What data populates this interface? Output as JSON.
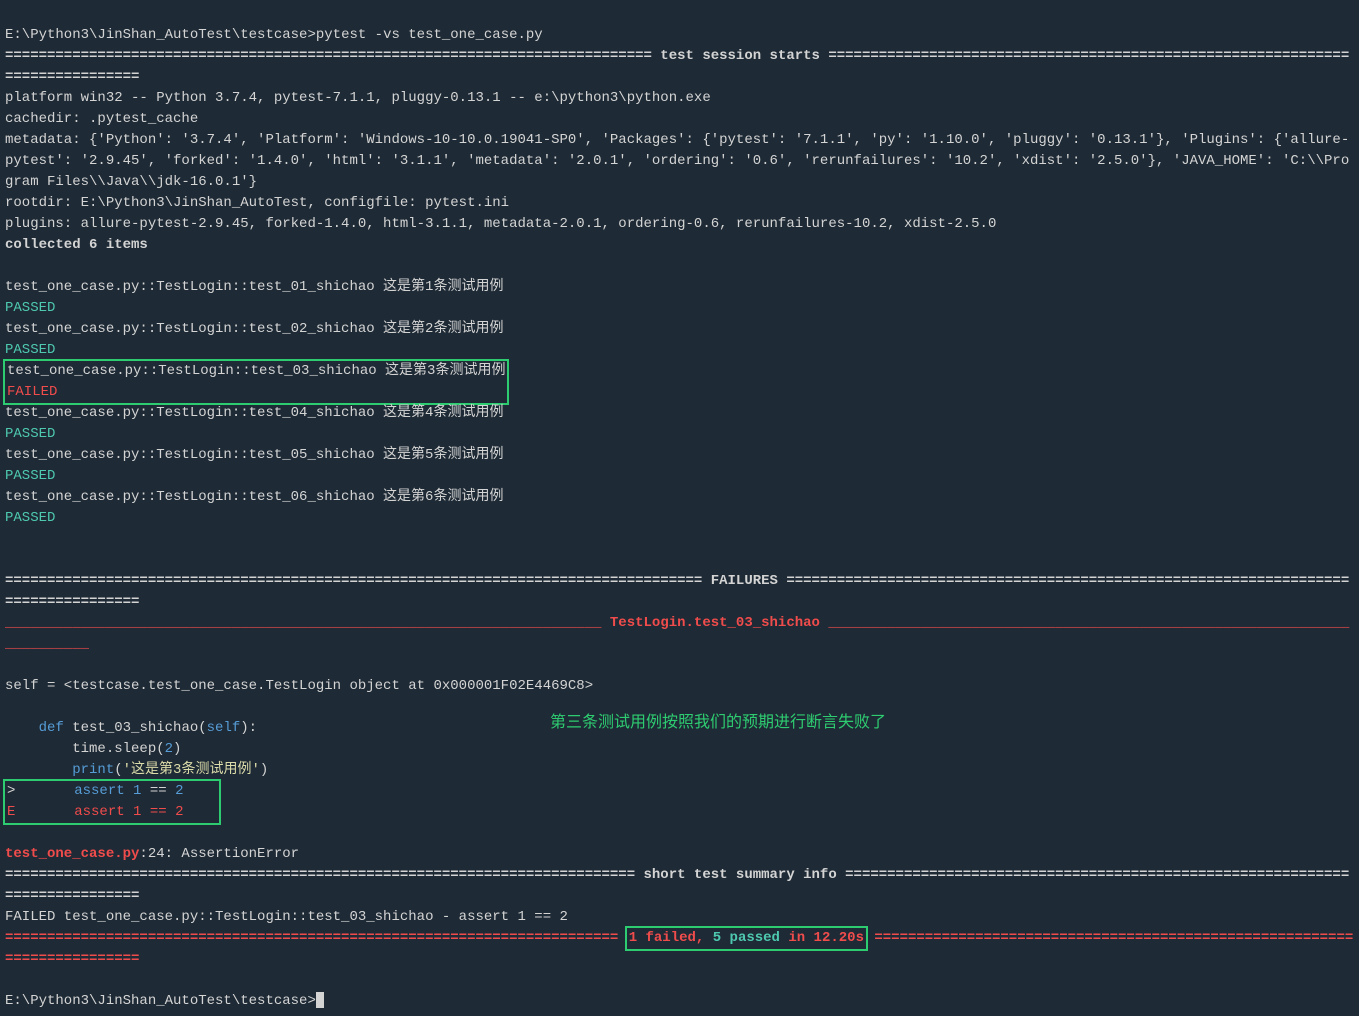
{
  "prompt1": "E:\\Python3\\JinShan_AutoTest\\testcase>",
  "command": "pytest -vs test_one_case.py",
  "session_start_line": "============================================================================= test session starts ==============================================================================",
  "platform_line": "platform win32 -- Python 3.7.4, pytest-7.1.1, pluggy-0.13.1 -- e:\\python3\\python.exe",
  "cachedir_line": "cachedir: .pytest_cache",
  "metadata_line": "metadata: {'Python': '3.7.4', 'Platform': 'Windows-10-10.0.19041-SP0', 'Packages': {'pytest': '7.1.1', 'py': '1.10.0', 'pluggy': '0.13.1'}, 'Plugins': {'allure-pytest': '2.9.45', 'forked': '1.4.0', 'html': '3.1.1', 'metadata': '2.0.1', 'ordering': '0.6', 'rerunfailures': '10.2', 'xdist': '2.5.0'}, 'JAVA_HOME': 'C:\\\\Program Files\\\\Java\\\\jdk-16.0.1'}",
  "rootdir_line": "rootdir: E:\\Python3\\JinShan_AutoTest, configfile: pytest.ini",
  "plugins_line": "plugins: allure-pytest-2.9.45, forked-1.4.0, html-3.1.1, metadata-2.0.1, ordering-0.6, rerunfailures-10.2, xdist-2.5.0",
  "collected_line": "collected 6 items",
  "tests": [
    {
      "line": "test_one_case.py::TestLogin::test_01_shichao 这是第1条测试用例",
      "result": "PASSED",
      "passed": true,
      "highlight": false
    },
    {
      "line": "test_one_case.py::TestLogin::test_02_shichao 这是第2条测试用例",
      "result": "PASSED",
      "passed": true,
      "highlight": false
    },
    {
      "line": "test_one_case.py::TestLogin::test_03_shichao 这是第3条测试用例",
      "result": "FAILED",
      "passed": false,
      "highlight": true
    },
    {
      "line": "test_one_case.py::TestLogin::test_04_shichao 这是第4条测试用例",
      "result": "PASSED",
      "passed": true,
      "highlight": false
    },
    {
      "line": "test_one_case.py::TestLogin::test_05_shichao 这是第5条测试用例",
      "result": "PASSED",
      "passed": true,
      "highlight": false
    },
    {
      "line": "test_one_case.py::TestLogin::test_06_shichao 这是第6条测试用例",
      "result": "PASSED",
      "passed": true,
      "highlight": false
    }
  ],
  "failures_header": "=================================================================================== FAILURES ===================================================================================",
  "failure_name_left": "_______________________________________________________________________ ",
  "failure_name": "TestLogin.test_03_shichao",
  "failure_name_right": " ________________________________________________________________________",
  "self_line": "self = <testcase.test_one_case.TestLogin object at 0x000001F02E4469C8>",
  "def_kw": "    def",
  "def_name": " test_03_shichao(",
  "self_kw": "self",
  "def_close": "):",
  "sleep_line": "        time.sleep(",
  "sleep_val": "2",
  "sleep_close": ")",
  "print_indent": "        ",
  "print_kw": "print",
  "print_open": "(",
  "print_str": "'这是第3条测试用例'",
  "print_close": ")",
  "assert_gt": ">       ",
  "assert_kw": "assert",
  "assert_sp": " ",
  "assert_1": "1",
  "assert_eq": " == ",
  "assert_2": "2",
  "assert_e": "E       ",
  "file_err": "test_one_case.py",
  "file_err_line": ":24: AssertionError",
  "summary_header": "=========================================================================== short test summary info ============================================================================",
  "failed_summary": "FAILED test_one_case.py::TestLogin::test_03_shichao - assert 1 == 2",
  "final_left": "========================================================================= ",
  "final_failed": "1 failed",
  "final_comma": ", ",
  "final_passed": "5 passed",
  "final_time": " in 12.20s",
  "final_right": " =========================================================================",
  "prompt2": "E:\\Python3\\JinShan_AutoTest\\testcase>",
  "annotation_text": "第三条测试用例按照我们的预期进行断言失败了"
}
